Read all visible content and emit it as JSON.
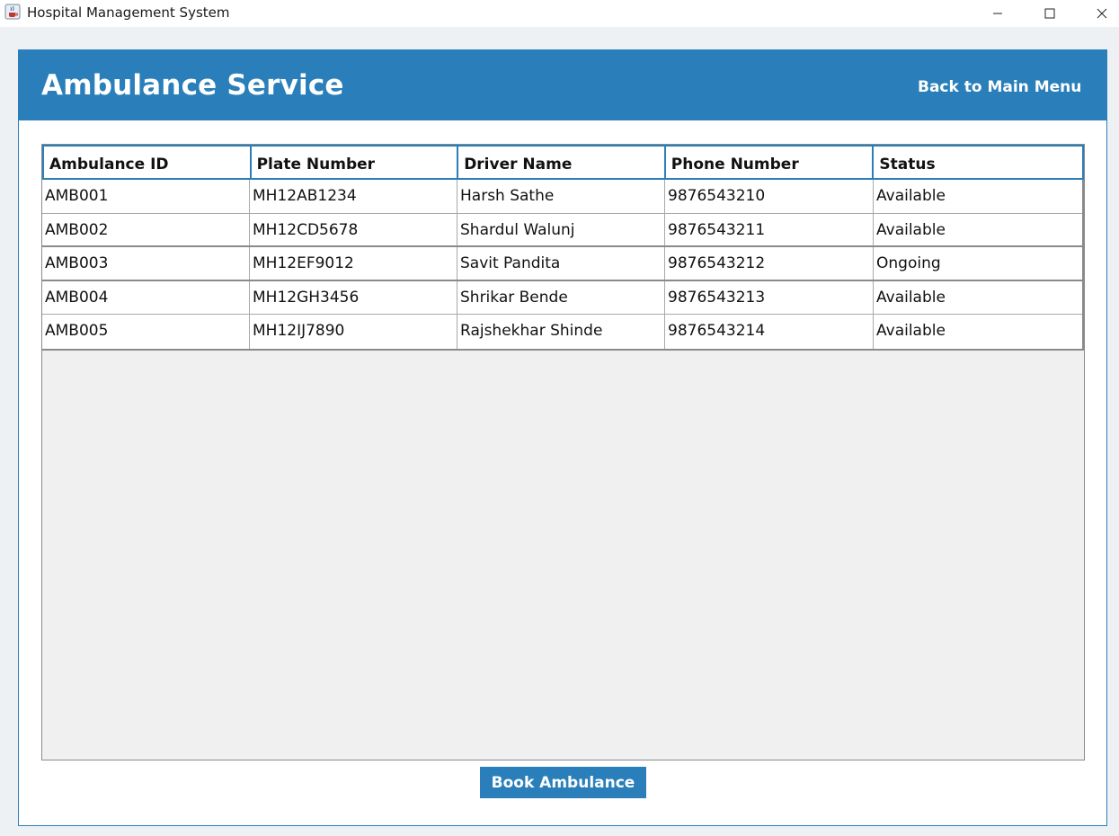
{
  "window": {
    "title": "Hospital Management System",
    "icon": "java-cup-icon"
  },
  "header": {
    "title": "Ambulance Service",
    "back_label": "Back to Main Menu",
    "color": "#2a7fba"
  },
  "table": {
    "columns": [
      "Ambulance ID",
      "Plate Number",
      "Driver Name",
      "Phone Number",
      "Status"
    ],
    "rows": [
      [
        "AMB001",
        "MH12AB1234",
        "Harsh Sathe",
        "9876543210",
        "Available"
      ],
      [
        "AMB002",
        "MH12CD5678",
        "Shardul Walunj",
        "9876543211",
        "Available"
      ],
      [
        "AMB003",
        "MH12EF9012",
        "Savit Pandita",
        "9876543212",
        "Ongoing"
      ],
      [
        "AMB004",
        "MH12GH3456",
        "Shrikar Bende",
        "9876543213",
        "Available"
      ],
      [
        "AMB005",
        "MH12IJ7890",
        "Rajshekhar Shinde",
        "9876543214",
        "Available"
      ]
    ]
  },
  "actions": {
    "book_label": "Book Ambulance"
  }
}
